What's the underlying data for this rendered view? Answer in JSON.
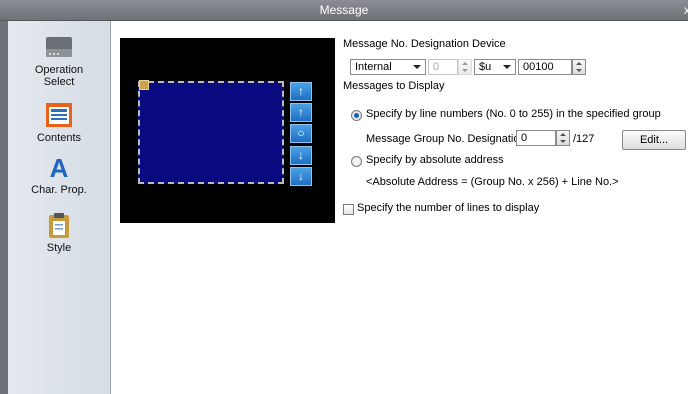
{
  "window": {
    "title": "Message",
    "close": "x"
  },
  "sidebar": {
    "items": [
      {
        "label": "Operation Select",
        "icon": "drive-icon"
      },
      {
        "label": "Contents",
        "icon": "contents-icon"
      },
      {
        "label": "Char. Prop.",
        "icon": "char-prop-icon"
      },
      {
        "label": "Style",
        "icon": "clipboard-icon"
      }
    ]
  },
  "preview": {
    "buttons": [
      "↑",
      "↑",
      "○",
      "↓",
      "↓"
    ]
  },
  "form": {
    "device_heading": "Message No. Designation Device",
    "device_type": "Internal",
    "device_num": "0",
    "device_addr_type": "$u",
    "device_addr": "00100",
    "messages_heading": "Messages to Display",
    "radio_line_numbers": "Specify by line numbers (No. 0 to 255) in the specified group",
    "group_label": "Message Group No. Designation",
    "group_value": "0",
    "group_max": "/127",
    "edit_button": "Edit...",
    "radio_absolute": "Specify by absolute address",
    "absolute_note": "<Absolute Address = (Group No. x 256) + Line No.>",
    "check_lines": "Specify the number of lines to display"
  }
}
